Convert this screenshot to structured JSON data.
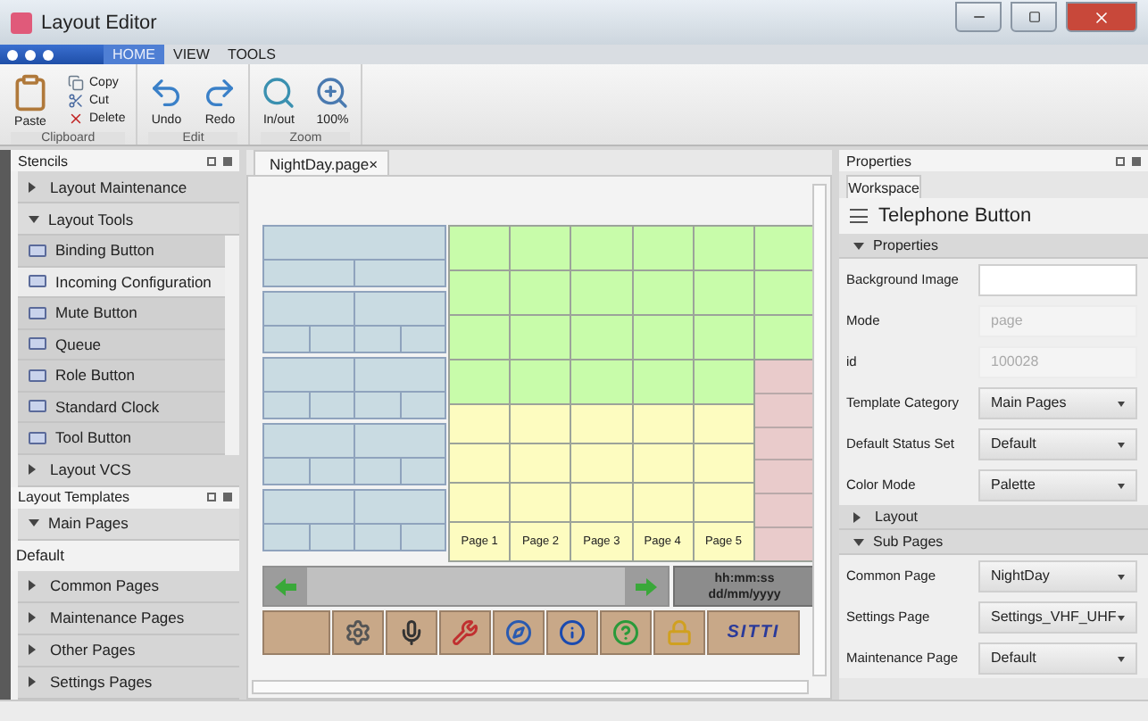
{
  "window": {
    "title": "Layout Editor"
  },
  "ribbon_tabs": [
    {
      "label": "HOME",
      "selected": true
    },
    {
      "label": "VIEW",
      "selected": false
    },
    {
      "label": "TOOLS",
      "selected": false
    }
  ],
  "ribbon_groups": [
    {
      "name": "Clipboard",
      "buttons": [
        {
          "label": "Paste",
          "kind": "large"
        },
        {
          "label": "Copy",
          "kind": "small"
        },
        {
          "label": "Cut",
          "kind": "small"
        },
        {
          "label": "Delete",
          "kind": "small"
        }
      ]
    },
    {
      "name": "Edit",
      "buttons": [
        {
          "label": "Undo",
          "kind": "large"
        },
        {
          "label": "Redo",
          "kind": "large"
        }
      ]
    },
    {
      "name": "Zoom",
      "buttons": [
        {
          "label": "In/out",
          "kind": "large"
        },
        {
          "label": "100%",
          "kind": "large"
        }
      ]
    }
  ],
  "stencils": {
    "title": "Stencils",
    "sections": [
      {
        "label": "Layout Maintenance",
        "expanded": false
      },
      {
        "label": "Layout Tools",
        "expanded": true,
        "items": [
          {
            "label": "Binding Button",
            "selected": false
          },
          {
            "label": "Incoming Configuration",
            "selected": true
          },
          {
            "label": "Mute Button",
            "selected": false
          },
          {
            "label": "Queue",
            "selected": false
          },
          {
            "label": "Role Button",
            "selected": false
          },
          {
            "label": "Standard Clock",
            "selected": false
          },
          {
            "label": "Tool Button",
            "selected": false
          }
        ]
      },
      {
        "label": "Layout VCS",
        "expanded": false
      }
    ]
  },
  "templates": {
    "title": "Layout Templates",
    "sections": [
      {
        "label": "Main Pages",
        "expanded": true,
        "items": [
          {
            "label": "Default",
            "selected": true
          }
        ]
      },
      {
        "label": "Common Pages",
        "expanded": false
      },
      {
        "label": "Maintenance Pages",
        "expanded": false
      },
      {
        "label": "Other Pages",
        "expanded": false
      },
      {
        "label": "Settings Pages",
        "expanded": false
      }
    ]
  },
  "document_tab": {
    "label": "NightDay.page",
    "close": "×"
  },
  "device": {
    "page_labels": [
      "Page 1",
      "Page 2",
      "Page 3",
      "Page 4",
      "Page 5"
    ],
    "clock": [
      "hh:mm:ss",
      "dd/mm/yyyy"
    ],
    "tool_buttons": [
      {
        "kind": "blank"
      },
      {
        "kind": "gears"
      },
      {
        "kind": "mic"
      },
      {
        "kind": "tools"
      },
      {
        "kind": "compass"
      },
      {
        "kind": "info"
      },
      {
        "kind": "help"
      },
      {
        "kind": "lock"
      },
      {
        "kind": "logo",
        "text": "SITTI"
      }
    ]
  },
  "properties": {
    "title": "Properties",
    "tab": "Workspace",
    "heading": "Telephone Button",
    "sections": [
      {
        "label": "Properties",
        "expanded": true,
        "fields": [
          {
            "label": "Background Image",
            "kind": "text"
          },
          {
            "label": "Mode",
            "kind": "readonly",
            "value": "page"
          },
          {
            "label": "id",
            "kind": "readonly",
            "value": "100028"
          },
          {
            "label": "Template Category",
            "kind": "dropdown",
            "value": "Main Pages"
          },
          {
            "label": "Default Status Set",
            "kind": "dropdown",
            "value": "Default"
          },
          {
            "label": "Color Mode",
            "kind": "dropdown",
            "value": "Palette"
          }
        ]
      },
      {
        "label": "Layout",
        "expanded": false
      },
      {
        "label": "Sub Pages",
        "expanded": true,
        "fields": [
          {
            "label": "Common Page",
            "kind": "dropdown",
            "value": "NightDay"
          },
          {
            "label": "Settings Page",
            "kind": "dropdown",
            "value": "Settings_VHF_UHF"
          },
          {
            "label": "Maintenance Page",
            "kind": "dropdown",
            "value": "Default"
          }
        ]
      }
    ]
  }
}
